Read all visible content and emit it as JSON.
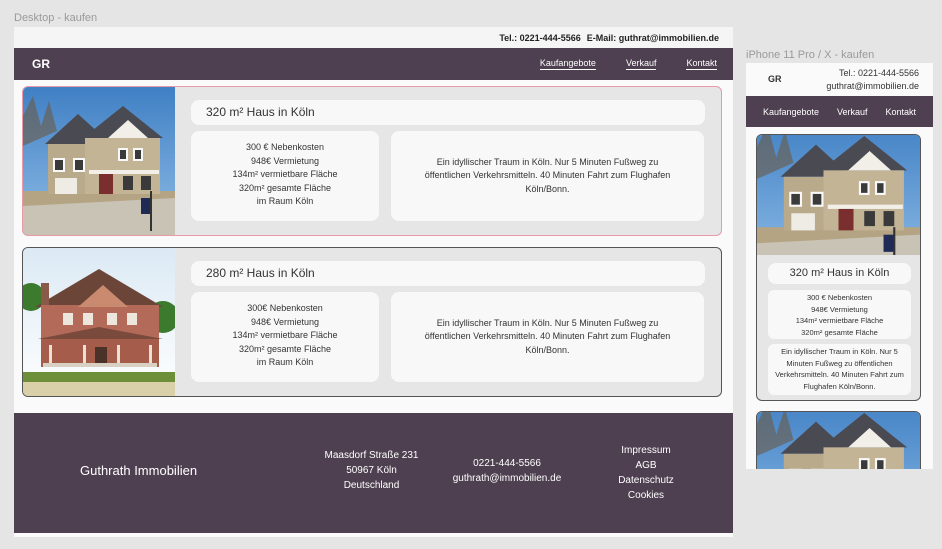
{
  "frames": {
    "desktop_label": "Desktop - kaufen",
    "mobile_label": "iPhone 11 Pro / X - kaufen"
  },
  "topbar": {
    "phone": "Tel.: 0221-444-5566",
    "email": "E-Mail: guthrat@immobilien.de"
  },
  "nav": {
    "logo": "GR",
    "links": [
      "Kaufangebote",
      "Verkauf",
      "Kontakt"
    ]
  },
  "listings": [
    {
      "title": "320 m² Haus in Köln",
      "facts": [
        "300 € Nebenkosten",
        "948€ Vermietung",
        "134m² vermietbare Fläche",
        "320m² gesamte Fläche",
        "im Raum Köln"
      ],
      "description": "Ein idyllischer Traum in Köln. Nur 5 Minuten Fußweg zu öffentlichen Verkehrsmitteln. 40 Minuten Fahrt zum Flughafen Köln/Bonn."
    },
    {
      "title": "280 m² Haus in Köln",
      "facts": [
        "300€ Nebenkosten",
        "948€ Vermietung",
        "134m² vermietbare Fläche",
        "320m² gesamte Fläche",
        "im Raum Köln"
      ],
      "description": "Ein idyllischer Traum in Köln. Nur 5 Minuten Fußweg zu öffentlichen Verkehrsmitteln. 40 Minuten Fahrt zum Flughafen Köln/Bonn."
    }
  ],
  "footer": {
    "brand": "Guthrath Immobilien",
    "address": [
      "Maasdorf Straße 231",
      "50967 Köln",
      "Deutschland"
    ],
    "contact": [
      "0221-444-5566",
      "guthrath@immobilien.de"
    ],
    "links": [
      "Impressum",
      "AGB",
      "Datenschutz",
      "Cookies"
    ]
  },
  "mobile": {
    "logo": "GR",
    "contact": [
      "Tel.: 0221-444-5566",
      "guthrat@immobilien.de"
    ],
    "nav": [
      "Kaufangebote",
      "Verkauf",
      "Kontakt"
    ],
    "listing": {
      "title": "320 m² Haus in Köln",
      "facts": [
        "300 € Nebenkosten",
        "948€ Vermietung",
        "134m² vermietbare Fläche",
        "320m² gesamte Fläche"
      ],
      "description": "Ein idyllischer Traum in Köln. Nur 5 Minuten Fußweg zu öffentlichen Verkehrsmitteln. 40 Minuten Fahrt zum Flughafen Köln/Bonn."
    }
  },
  "colors": {
    "brand": "#4e4050",
    "card_bg": "#e6e6e6",
    "highlight_border": "#e89aa6"
  }
}
